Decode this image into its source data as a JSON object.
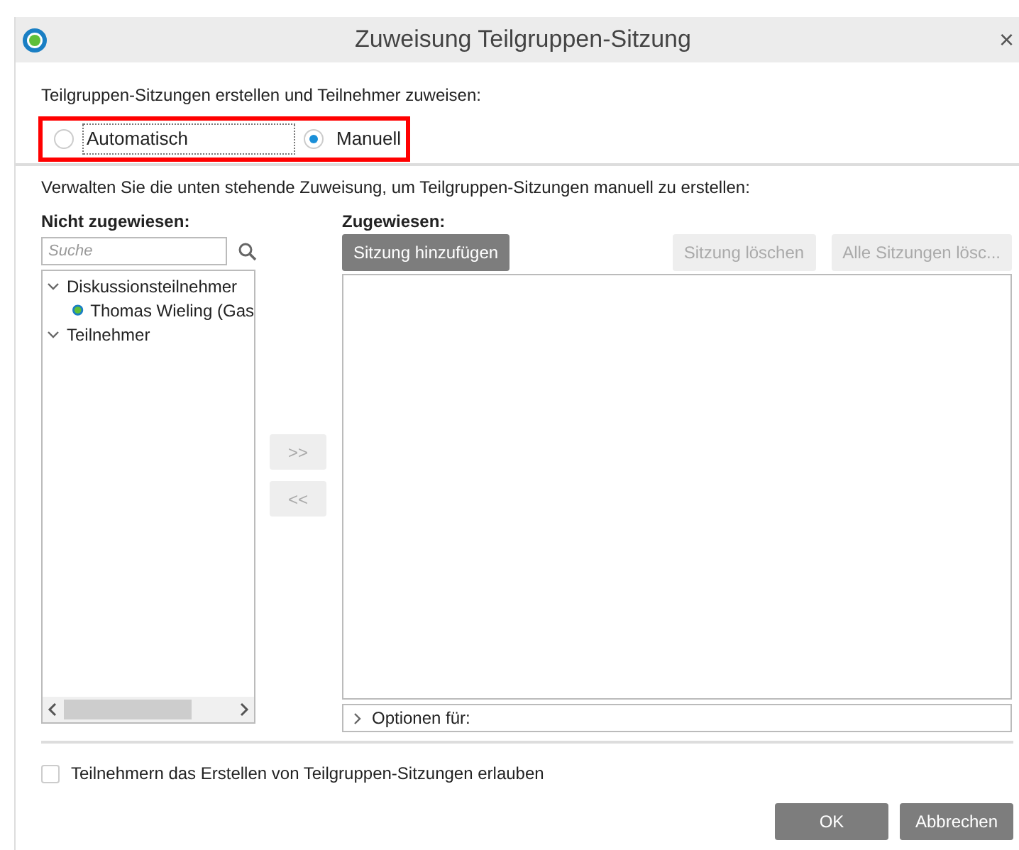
{
  "window": {
    "title": "Zuweisung Teilgruppen-Sitzung",
    "close": "×"
  },
  "mode": {
    "label": "Teilgruppen-Sitzungen erstellen und Teilnehmer zuweisen:",
    "highlighted": true,
    "options": [
      {
        "label": "Automatisch",
        "selected": false,
        "focused": true
      },
      {
        "label": "Manuell",
        "selected": true,
        "focused": false
      }
    ]
  },
  "instructions": "Verwalten Sie die unten stehende Zuweisung, um Teilgruppen-Sitzungen manuell zu erstellen:",
  "unassigned": {
    "heading": "Nicht zugewiesen:",
    "search": {
      "placeholder": "Suche"
    },
    "tree": [
      {
        "label": "Diskussionsteilnehmer",
        "expanded": true,
        "children": [
          {
            "label": "Thomas Wieling (Gas",
            "kind": "person"
          }
        ]
      },
      {
        "label": "Teilnehmer",
        "expanded": true
      }
    ]
  },
  "move_buttons": [
    {
      "label": ">>",
      "disabled": true
    },
    {
      "label": "<<",
      "disabled": true
    }
  ],
  "assigned": {
    "heading": "Zugewiesen:",
    "buttons": [
      {
        "label": "Sitzung hinzufügen",
        "disabled": false
      },
      {
        "label": "Sitzung löschen",
        "disabled": true
      },
      {
        "label": "Alle Sitzungen lösc...",
        "disabled": true
      }
    ],
    "options_label": "Optionen für:",
    "options_expanded": false
  },
  "allow_checkbox": {
    "label": "Teilnehmern das Erstellen von Teilgruppen-Sitzungen erlauben",
    "checked": false
  },
  "footer_buttons": [
    {
      "label": "OK"
    },
    {
      "label": "Abbrechen"
    }
  ]
}
